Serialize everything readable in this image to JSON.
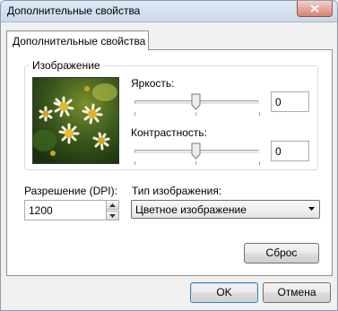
{
  "window": {
    "title": "Дополнительные свойства"
  },
  "tab": {
    "label": "Дополнительные свойства"
  },
  "image_group": {
    "title": "Изображение",
    "brightness": {
      "label": "Яркость:",
      "value": "0"
    },
    "contrast": {
      "label": "Контрастность:",
      "value": "0"
    }
  },
  "resolution": {
    "label": "Разрешение (DPI):",
    "value": "1200"
  },
  "image_type": {
    "label": "Тип изображения:",
    "selected": "Цветное изображение"
  },
  "buttons": {
    "reset": "Сброс",
    "ok": "OK",
    "cancel": "Отмена"
  },
  "icons": {
    "close": "close-icon",
    "spin_up": "arrow-up-icon",
    "spin_down": "arrow-down-icon",
    "dropdown": "chevron-down-icon"
  },
  "colors": {
    "default_button_border": "#3c7fb1",
    "close_button": "#d9826f"
  }
}
